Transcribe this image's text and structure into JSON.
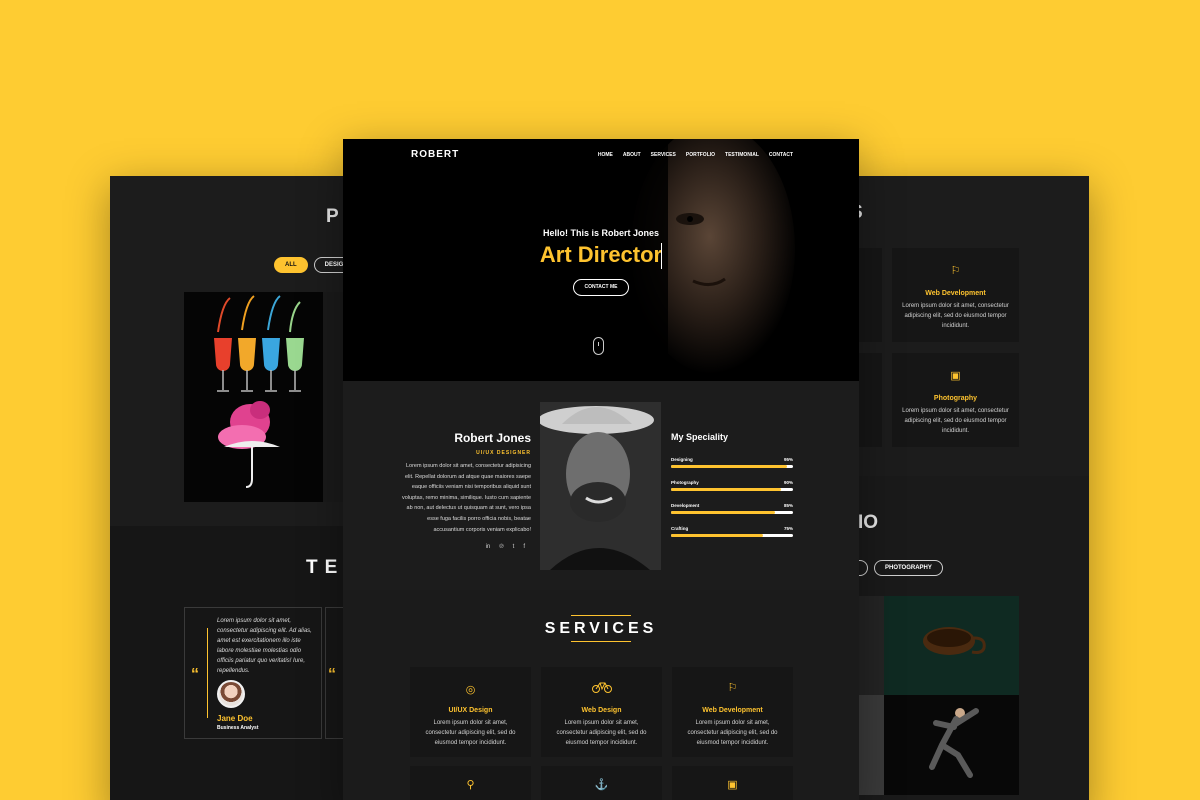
{
  "colors": {
    "background": "#fecc32",
    "accent": "#fec32f",
    "panel": "#1b1b1b"
  },
  "left_panel": {
    "section_title": "PO",
    "filters": [
      "ALL",
      "DESIGN"
    ],
    "testimonial_title": "TES",
    "testimonial": {
      "text": "Lorem ipsum dolor sit amet, consectetur adipiscing elit. Ad alias, amet est exercitationem illo iste labore molestiae molestias odio officiis pariatur quo veritatis! Iure, repellendus.",
      "name": "Jane Doe",
      "role": "Business Analyst",
      "quote_icon": "quote-icon"
    }
  },
  "center_panel": {
    "logo": "ROBERT",
    "nav": [
      "HOME",
      "ABOUT",
      "SERVICES",
      "PORTFOLIO",
      "TESTIMONIAL",
      "CONTACT"
    ],
    "hero": {
      "greeting": "Hello! This is Robert Jones",
      "role": "Art Director",
      "cta": "CONTACT ME"
    },
    "about": {
      "name": "Robert Jones",
      "role": "UI/UX DESIGNER",
      "text": "Lorem ipsum dolor sit amet, consectetur adipisicing elit. Repellat dolorum ad atque quae maiores saepe eaque officiis veniam nisi temporibus aliquid sunt voluptas, remo minima, similique. Iusto cum sapiente ab non, aut delectus ut quisquam at sunt, vero ipsa esse fuga facilis porro officia nobis, beatae accusantium corporis veniam explicabo!",
      "social_icons": [
        "in",
        "℗",
        "t",
        "f"
      ]
    },
    "speciality": {
      "title": "My Speciality",
      "skills": [
        {
          "name": "Designing",
          "label": "95%",
          "value": 0.95
        },
        {
          "name": "Photography",
          "label": "90%",
          "value": 0.9
        },
        {
          "name": "Development",
          "label": "85%",
          "value": 0.85
        },
        {
          "name": "Crafting",
          "label": "75%",
          "value": 0.75
        }
      ]
    },
    "services": {
      "title": "SERVICES",
      "desc": "Lorem ipsum dolor sit amet, consectetur adipiscing elit, sed do eiusmod tempor incididunt.",
      "items": [
        {
          "name": "UI/UX Design",
          "icon": "aperture-icon"
        },
        {
          "name": "Web Design",
          "icon": "bicycle-icon"
        },
        {
          "name": "Web Development",
          "icon": "flag-icon"
        }
      ]
    }
  },
  "right_panel": {
    "section_title_1": "S",
    "section_title_2": "IO",
    "filter_partial": "",
    "filter": "PHOTOGRAPHY",
    "services": [
      {
        "name": "Web Development",
        "icon": "flag-icon"
      },
      {
        "name": "Photography",
        "icon": "paint-brush-icon"
      }
    ],
    "desc": "Lorem ipsum dolor sit amet, consectetur adipiscing elit, sed do eiusmod tempor incididunt."
  }
}
